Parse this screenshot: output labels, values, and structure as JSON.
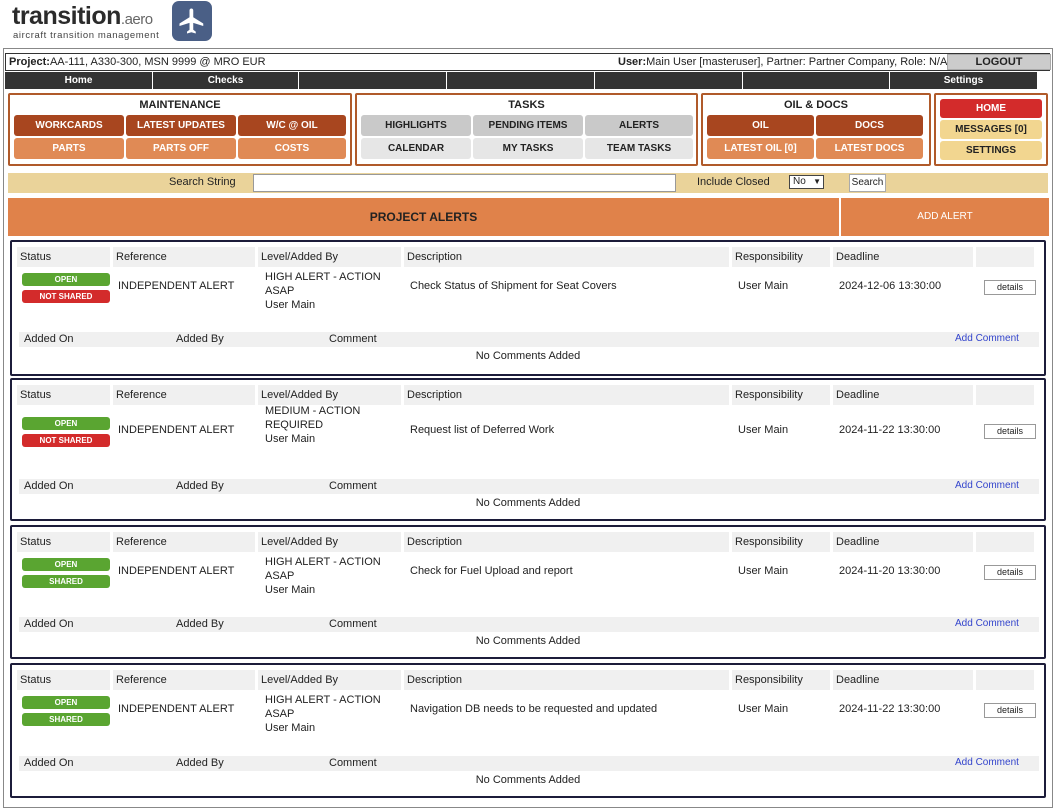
{
  "logo": {
    "main": "transition",
    "suffix": ".aero",
    "tagline": "aircraft transition management"
  },
  "project_bar": {
    "project_label": "Project:",
    "project_value": " AA-111, A330-300, MSN 9999 @ MRO EUR",
    "user_label": "User:",
    "user_value": "Main User [masteruser], Partner: Partner Company, Role: N/A",
    "logout": "LOGOUT"
  },
  "nav": [
    "Home",
    "Checks",
    "",
    "",
    "",
    "",
    "Settings"
  ],
  "maintenance": {
    "title": "MAINTENANCE",
    "buttons": [
      "WORKCARDS",
      "LATEST UPDATES",
      "W/C @ OIL",
      "PARTS",
      "PARTS OFF",
      "COSTS"
    ]
  },
  "tasks": {
    "title": "TASKS",
    "buttons": [
      "HIGHLIGHTS",
      "PENDING ITEMS",
      "ALERTS",
      "CALENDAR",
      "MY TASKS",
      "TEAM TASKS"
    ]
  },
  "oil_docs": {
    "title": "OIL & DOCS",
    "buttons": [
      "OIL",
      "DOCS",
      "LATEST OIL [0]",
      "LATEST DOCS"
    ]
  },
  "quick": {
    "buttons": [
      "HOME",
      "MESSAGES [0]",
      "SETTINGS"
    ]
  },
  "search": {
    "label": "Search String",
    "value": "",
    "include_closed_label": "Include Closed",
    "include_closed_value": "No",
    "button": "Search"
  },
  "alerts_header": {
    "title": "PROJECT ALERTS",
    "add": "ADD ALERT"
  },
  "table_headers": {
    "status": "Status",
    "reference": "Reference",
    "level": "Level/Added By",
    "description": "Description",
    "responsibility": "Responsibility",
    "deadline": "Deadline"
  },
  "comment_headers": {
    "added_on": "Added On",
    "added_by": "Added By",
    "comment": "Comment",
    "add": "Add Comment",
    "none": "No Comments Added"
  },
  "details_label": "details",
  "alerts": [
    {
      "status": "OPEN",
      "share": "NOT SHARED",
      "share_color": "#d32b2b",
      "reference": "INDEPENDENT ALERT",
      "level_lines": [
        "HIGH ALERT - ACTION ASAP",
        "User Main"
      ],
      "description": "Check Status of Shipment for Seat Covers",
      "responsibility": "User Main",
      "deadline": "2024-12-06 13:30:00"
    },
    {
      "status": "OPEN",
      "share": "NOT SHARED",
      "share_color": "#d32b2b",
      "reference": "INDEPENDENT ALERT",
      "level_lines": [
        "MEDIUM - ACTION",
        "REQUIRED",
        "User Main"
      ],
      "description": "Request list of Deferred Work",
      "responsibility": "User Main",
      "deadline": "2024-11-22 13:30:00"
    },
    {
      "status": "OPEN",
      "share": "SHARED",
      "share_color": "#5aa531",
      "reference": "INDEPENDENT ALERT",
      "level_lines": [
        "HIGH ALERT - ACTION ASAP",
        "User Main"
      ],
      "description": "Check for Fuel Upload and report",
      "responsibility": "User Main",
      "deadline": "2024-11-20 13:30:00"
    },
    {
      "status": "OPEN",
      "share": "SHARED",
      "share_color": "#5aa531",
      "reference": "INDEPENDENT ALERT",
      "level_lines": [
        "HIGH ALERT - ACTION ASAP",
        "User Main"
      ],
      "description": "Navigation DB needs to be requested and updated",
      "responsibility": "User Main",
      "deadline": "2024-11-22 13:30:00"
    }
  ],
  "colors": {
    "dark_orange": "#a8461f",
    "light_orange": "#e08a55",
    "home_red": "#d32b2b",
    "yellow": "#f2d690",
    "open_green": "#5aa531",
    "search_bar": "#ead39a"
  },
  "icons": {
    "logo_plane": "airplane-icon"
  }
}
